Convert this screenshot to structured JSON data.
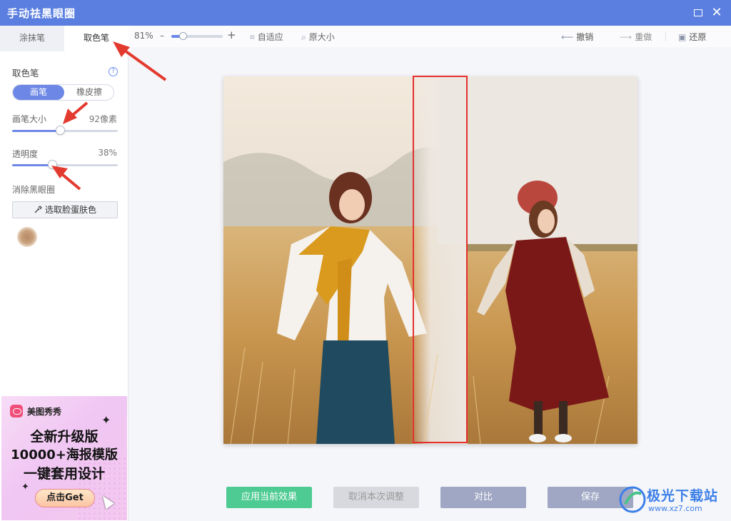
{
  "window": {
    "title": "手动祛黑眼圈"
  },
  "sidebar": {
    "tabs": [
      "涂抹笔",
      "取色笔"
    ],
    "section_title": "取色笔",
    "mode_options": [
      "画笔",
      "橡皮擦"
    ],
    "brush_size": {
      "label": "画笔大小",
      "value": "92像素",
      "level": 0.45
    },
    "opacity": {
      "label": "透明度",
      "value": "38%",
      "level": 0.38
    },
    "remove_section": "消除黑眼圈",
    "pick_button": "选取脸蛋肤色",
    "swatch_color": "#c4a07c"
  },
  "ad": {
    "brand": "美图秀秀",
    "line1": "全新升级版",
    "line2": "10000+海报模版",
    "line3": "一键套用设计",
    "cta": "点击Get"
  },
  "toolbar": {
    "zoom": "81%",
    "zoom_level": 0.22,
    "fit": "自适应",
    "original": "原大小",
    "undo": "撤销",
    "redo": "重做",
    "restore": "还原"
  },
  "actions": {
    "apply": "应用当前效果",
    "cancel": "取消本次调整",
    "compare": "对比",
    "save": "保存"
  },
  "watermark": {
    "name": "极光下载站",
    "url": "www.xz7.com"
  },
  "colors": {
    "titlebar": "#5b7fe0",
    "accent": "#6d87e6",
    "apply": "#4ecb93",
    "selection": "#e3302f"
  }
}
